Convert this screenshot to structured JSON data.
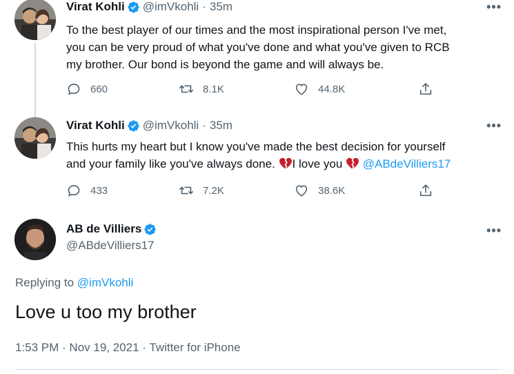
{
  "tweets": [
    {
      "name": "Virat Kohli",
      "handle": "@imVkohli",
      "separator": "·",
      "time": "35m",
      "more": "•••",
      "text_lines": [
        "To the best player of our times and the most inspirational person I've met,",
        "you can be very proud of what you've done and what you've given to RCB",
        "my brother. Our bond is beyond the game and will always be."
      ],
      "replies": "660",
      "retweets": "8.1K",
      "likes": "44.8K"
    },
    {
      "name": "Virat Kohli",
      "handle": "@imVkohli",
      "separator": "·",
      "time": "35m",
      "more": "•••",
      "text_line1": "This hurts my heart but I know you've made the best decision for yourself",
      "text_line2_a": "and your family like you've always done. ",
      "text_line2_b": "I love you ",
      "mention": "@ABdeVilliers17",
      "replies": "433",
      "retweets": "7.2K",
      "likes": "38.6K"
    }
  ],
  "main_tweet": {
    "name": "AB de Villiers",
    "handle": "@ABdeVilliers17",
    "more": "•••",
    "replying_prefix": "Replying to ",
    "replying_to": "@imVkohli",
    "text": "Love u too my brother",
    "meta": "1:53 PM · Nov 19, 2021 · Twitter for iPhone"
  },
  "icons": [
    "verified-badge-icon",
    "reply-icon",
    "retweet-icon",
    "like-icon",
    "share-icon",
    "more-icon",
    "broken-heart-icon"
  ],
  "colors": {
    "accent": "#1d9bf0",
    "muted": "#536471",
    "text": "#0f1419",
    "broken_heart": "#c4202f"
  }
}
